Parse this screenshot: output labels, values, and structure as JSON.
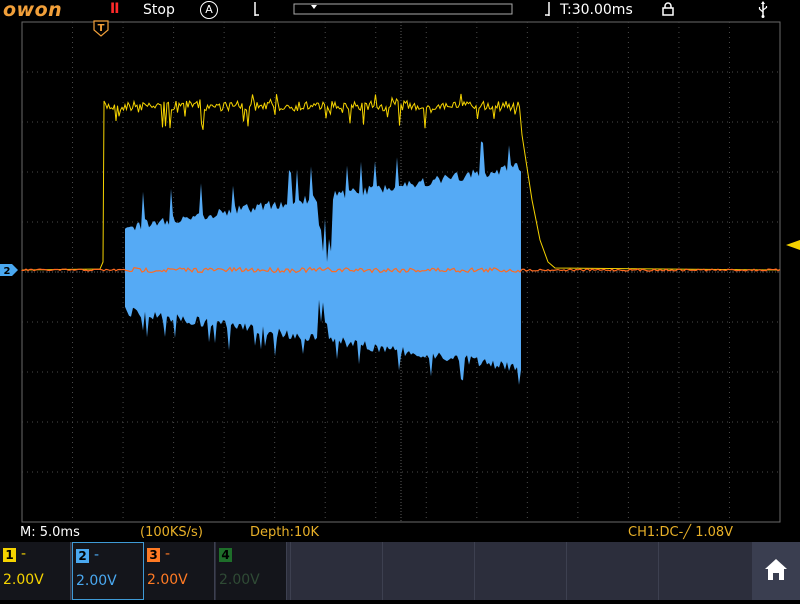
{
  "brand": "owon",
  "top": {
    "run_state": "Stop",
    "acq_mode": "A",
    "timebase": "T:30.00ms"
  },
  "info": {
    "main_scale": "M: 5.0ms",
    "sample_rate": "(100KS/s)",
    "depth": "Depth:10K",
    "trigger": "CH1:DC-╱ 1.08V"
  },
  "channels": [
    {
      "id": "1",
      "coupling": "-",
      "volts": "2.00V",
      "color": "#f5d300"
    },
    {
      "id": "2",
      "coupling": "-",
      "volts": "2.00V",
      "color": "#4aa8f0"
    },
    {
      "id": "3",
      "coupling": "-",
      "volts": "2.00V",
      "color": "#ff7a24"
    },
    {
      "id": "4",
      "coupling": "",
      "volts": "2.00V",
      "color": "#22a83a"
    }
  ],
  "markers": {
    "trigger": "T",
    "ch2_ref": "2"
  },
  "colors": {
    "ch1": "#f5d300",
    "ch2": "#55aaf5",
    "ch3": "#ff6a20",
    "grid": "#5a5a5a",
    "brand": "#f2a03a"
  }
}
